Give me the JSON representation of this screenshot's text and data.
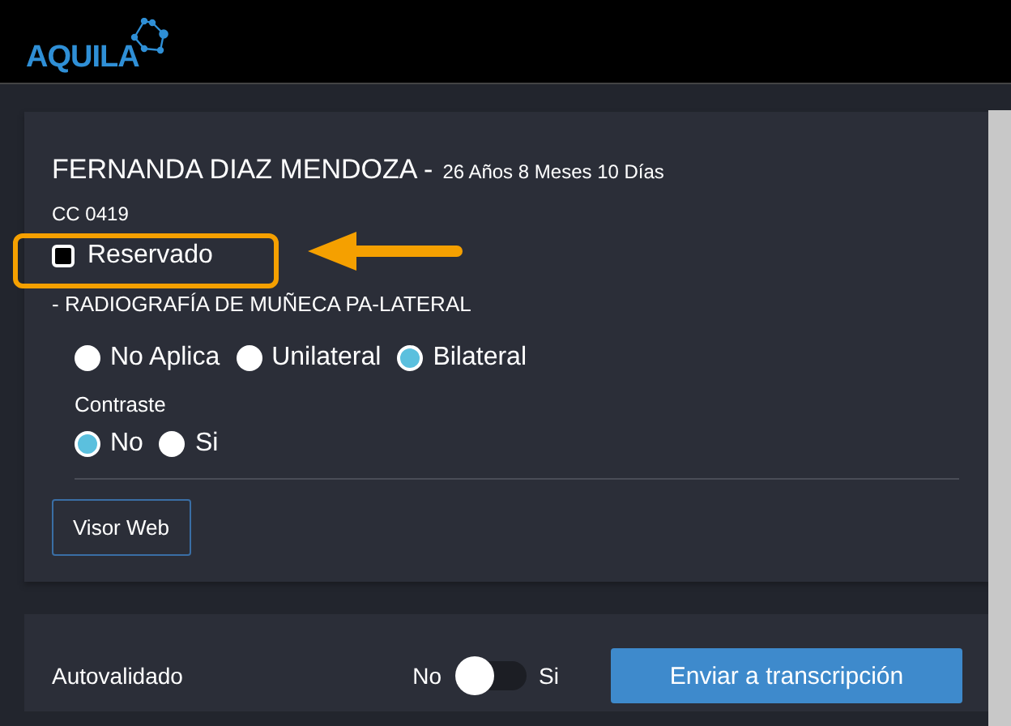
{
  "header": {
    "logo": "AQUILA"
  },
  "patient": {
    "name": "FERNANDA DIAZ MENDOZA -",
    "age": "26 Años 8 Meses 10 Días",
    "id": "CC 0419",
    "reserved": {
      "label": "Reservado",
      "checked": false,
      "highlighted": true
    },
    "study": "- RADIOGRAFÍA DE MUÑECA PA-LATERAL",
    "laterality": [
      {
        "label": "No Aplica",
        "selected": false
      },
      {
        "label": "Unilateral",
        "selected": false
      },
      {
        "label": "Bilateral",
        "selected": true
      }
    ],
    "contrast": {
      "label": "Contraste",
      "options": [
        {
          "label": "No",
          "selected": true
        },
        {
          "label": "Si",
          "selected": false
        }
      ]
    },
    "viewer_button": "Visor Web"
  },
  "footer": {
    "label": "Autovalidado",
    "off_label": "No",
    "on_label": "Si",
    "on": false,
    "button": "Enviar a transcripción"
  }
}
